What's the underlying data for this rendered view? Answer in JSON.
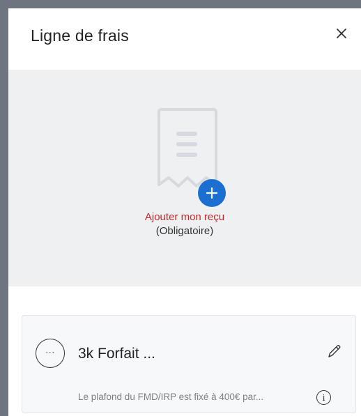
{
  "modal": {
    "title": "Ligne de frais",
    "close_icon": "close-icon"
  },
  "upload": {
    "icon": "receipt-icon",
    "add_icon": "plus-icon",
    "label": "Ajouter mon reçu",
    "required_label": "(Obligatoire)",
    "label_color": "#c62828",
    "button_color": "#1b6fd1"
  },
  "expense_card": {
    "menu_icon": "more-icon",
    "menu_label": "···",
    "title": "3k Forfait ...",
    "edit_icon": "pencil-icon",
    "note": "Le plafond du FMD/IRP est fixé à 400€ par...",
    "info_icon": "info-icon",
    "info_label": "i"
  }
}
